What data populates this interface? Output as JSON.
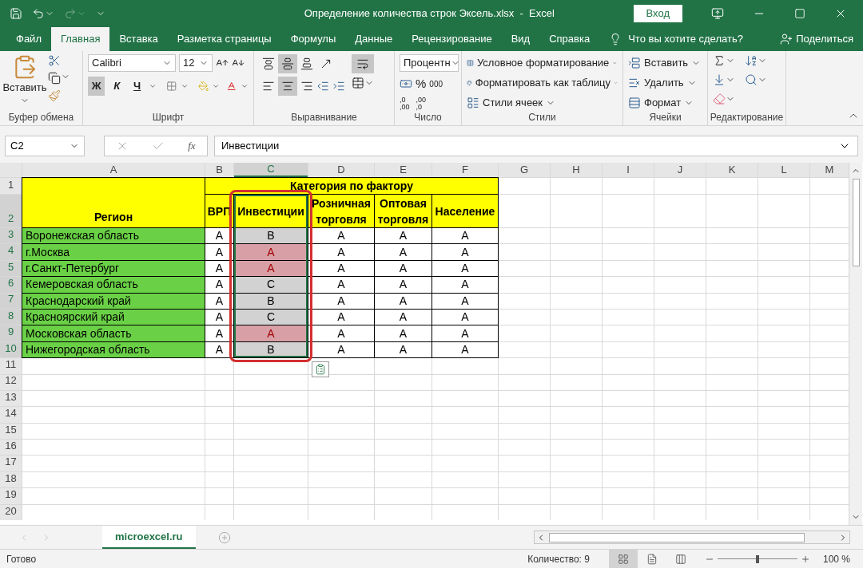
{
  "window": {
    "title": "Определение количества строк Эксель.xlsx  -  Excel",
    "sign_in": "Вход"
  },
  "ribbon_tabs": [
    {
      "label": "Файл",
      "selected": false
    },
    {
      "label": "Главная",
      "selected": true
    },
    {
      "label": "Вставка",
      "selected": false
    },
    {
      "label": "Разметка страницы",
      "selected": false
    },
    {
      "label": "Формулы",
      "selected": false
    },
    {
      "label": "Данные",
      "selected": false
    },
    {
      "label": "Рецензирование",
      "selected": false
    },
    {
      "label": "Вид",
      "selected": false
    },
    {
      "label": "Справка",
      "selected": false
    }
  ],
  "tell_me": "Что вы хотите сделать?",
  "share": "Поделиться",
  "ribbon": {
    "clipboard": {
      "paste": "Вставить",
      "label": "Буфер обмена"
    },
    "font": {
      "name": "Calibri",
      "size": "12",
      "styles": [
        {
          "label": "Ж",
          "on": true
        },
        {
          "label": "К",
          "on": false
        },
        {
          "label": "Ч",
          "on": false
        }
      ],
      "label": "Шрифт"
    },
    "alignment": {
      "vertical": [
        {
          "selected": false
        },
        {
          "selected": true
        },
        {
          "selected": false
        }
      ],
      "horizontal": [
        {
          "selected": false
        },
        {
          "selected": true
        },
        {
          "selected": false
        }
      ],
      "wrap_text": true,
      "label": "Выравнивание"
    },
    "number": {
      "format": "Процентн",
      "percent": "%",
      "thousands": "000",
      "increase_decimal": [
        ",0",
        ",00"
      ],
      "decrease_decimal": [
        ",00",
        ",0"
      ],
      "label": "Число"
    },
    "styles": {
      "items": [
        "Условное форматирование",
        "Форматировать как таблицу",
        "Стили ячеек"
      ],
      "label": "Стили"
    },
    "cells": {
      "items": [
        "Вставить",
        "Удалить",
        "Формат"
      ],
      "label": "Ячейки"
    },
    "editing": {
      "label": "Редактирование"
    }
  },
  "formula_bar": {
    "name_box": "C2",
    "fx": "fx",
    "formula": "Инвестиции"
  },
  "sheet": {
    "columns": [
      {
        "label": "A",
        "selected": false
      },
      {
        "label": "B",
        "selected": false
      },
      {
        "label": "C",
        "selected": true
      },
      {
        "label": "D",
        "selected": false
      },
      {
        "label": "E",
        "selected": false
      },
      {
        "label": "F",
        "selected": false
      },
      {
        "label": "G",
        "selected": false
      },
      {
        "label": "H",
        "selected": false
      },
      {
        "label": "I",
        "selected": false
      },
      {
        "label": "J",
        "selected": false
      },
      {
        "label": "K",
        "selected": false
      },
      {
        "label": "L",
        "selected": false
      },
      {
        "label": "M",
        "selected": false
      }
    ],
    "rows": [
      {
        "number": "1",
        "selected": false
      },
      {
        "number": "2",
        "selected": true
      },
      {
        "number": "3",
        "selected": true
      },
      {
        "number": "4",
        "selected": true
      },
      {
        "number": "5",
        "selected": true
      },
      {
        "number": "6",
        "selected": true
      },
      {
        "number": "7",
        "selected": true
      },
      {
        "number": "8",
        "selected": true
      },
      {
        "number": "9",
        "selected": true
      },
      {
        "number": "10",
        "selected": true
      },
      {
        "number": "11",
        "selected": false
      },
      {
        "number": "12",
        "selected": false
      },
      {
        "number": "13",
        "selected": false
      },
      {
        "number": "14",
        "selected": false
      },
      {
        "number": "15",
        "selected": false
      },
      {
        "number": "16",
        "selected": false
      },
      {
        "number": "17",
        "selected": false
      },
      {
        "number": "18",
        "selected": false
      },
      {
        "number": "19",
        "selected": false
      },
      {
        "number": "20",
        "selected": false
      }
    ],
    "table": {
      "region_header": "Регион",
      "category_header": "Категория по фактору",
      "factors": [
        "ВРП",
        "Инвестиции",
        "Розничная торговля",
        "Оптовая торговля",
        "Население"
      ],
      "data": [
        {
          "region": "Воронежская область",
          "values": [
            {
              "text": "A",
              "selected": false,
              "highlighted": false
            },
            {
              "text": "B",
              "selected": true,
              "highlighted": false
            },
            {
              "text": "A",
              "selected": false,
              "highlighted": false
            },
            {
              "text": "A",
              "selected": false,
              "highlighted": false
            },
            {
              "text": "A",
              "selected": false,
              "highlighted": false
            }
          ]
        },
        {
          "region": "г.Москва",
          "values": [
            {
              "text": "A",
              "selected": false,
              "highlighted": false
            },
            {
              "text": "A",
              "selected": true,
              "highlighted": true
            },
            {
              "text": "A",
              "selected": false,
              "highlighted": false
            },
            {
              "text": "A",
              "selected": false,
              "highlighted": false
            },
            {
              "text": "A",
              "selected": false,
              "highlighted": false
            }
          ]
        },
        {
          "region": "г.Санкт-Петербург",
          "values": [
            {
              "text": "A",
              "selected": false,
              "highlighted": false
            },
            {
              "text": "A",
              "selected": true,
              "highlighted": true
            },
            {
              "text": "A",
              "selected": false,
              "highlighted": false
            },
            {
              "text": "A",
              "selected": false,
              "highlighted": false
            },
            {
              "text": "A",
              "selected": false,
              "highlighted": false
            }
          ]
        },
        {
          "region": "Кемеровская область",
          "values": [
            {
              "text": "A",
              "selected": false,
              "highlighted": false
            },
            {
              "text": "C",
              "selected": true,
              "highlighted": false
            },
            {
              "text": "A",
              "selected": false,
              "highlighted": false
            },
            {
              "text": "A",
              "selected": false,
              "highlighted": false
            },
            {
              "text": "A",
              "selected": false,
              "highlighted": false
            }
          ]
        },
        {
          "region": "Краснодарский край",
          "values": [
            {
              "text": "A",
              "selected": false,
              "highlighted": false
            },
            {
              "text": "B",
              "selected": true,
              "highlighted": false
            },
            {
              "text": "A",
              "selected": false,
              "highlighted": false
            },
            {
              "text": "A",
              "selected": false,
              "highlighted": false
            },
            {
              "text": "A",
              "selected": false,
              "highlighted": false
            }
          ]
        },
        {
          "region": "Красноярский край",
          "values": [
            {
              "text": "A",
              "selected": false,
              "highlighted": false
            },
            {
              "text": "C",
              "selected": true,
              "highlighted": false
            },
            {
              "text": "A",
              "selected": false,
              "highlighted": false
            },
            {
              "text": "A",
              "selected": false,
              "highlighted": false
            },
            {
              "text": "A",
              "selected": false,
              "highlighted": false
            }
          ]
        },
        {
          "region": "Московская область",
          "values": [
            {
              "text": "A",
              "selected": false,
              "highlighted": false
            },
            {
              "text": "A",
              "selected": true,
              "highlighted": true
            },
            {
              "text": "A",
              "selected": false,
              "highlighted": false
            },
            {
              "text": "A",
              "selected": false,
              "highlighted": false
            },
            {
              "text": "A",
              "selected": false,
              "highlighted": false
            }
          ]
        },
        {
          "region": "Нижегородская область",
          "values": [
            {
              "text": "A",
              "selected": false,
              "highlighted": false
            },
            {
              "text": "B",
              "selected": true,
              "highlighted": false
            },
            {
              "text": "A",
              "selected": false,
              "highlighted": false
            },
            {
              "text": "A",
              "selected": false,
              "highlighted": false
            },
            {
              "text": "A",
              "selected": false,
              "highlighted": false
            }
          ]
        }
      ]
    }
  },
  "sheet_tabs": [
    {
      "label": "microexcel.ru",
      "selected": true
    }
  ],
  "status_bar": {
    "status": "Готово",
    "count": "Количество: 9",
    "views": [
      {
        "selected": true
      },
      {
        "selected": false
      },
      {
        "selected": false
      }
    ],
    "zoom_slider": {
      "level": 0.5
    },
    "zoom": "100 %"
  }
}
